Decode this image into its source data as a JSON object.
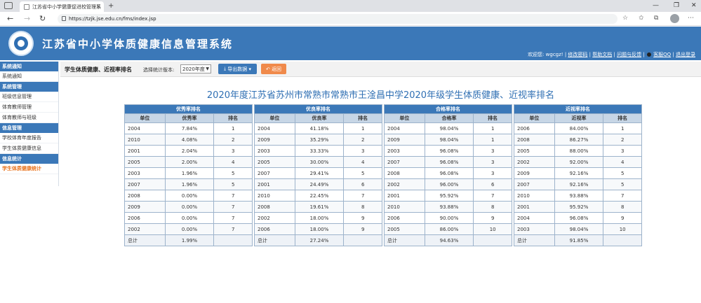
{
  "browser": {
    "tab_title": "江苏省中小学健康促进校管理系",
    "url": "https://tzjk.jse.edu.cn/fms/index.jsp"
  },
  "header": {
    "title": "江苏省中小学体质健康信息管理系统",
    "welcome": "欢迎您: wgcgz!",
    "links": [
      "修改密码",
      "帮助文档",
      "问题与反馈",
      "客服QQ",
      "退出登录"
    ]
  },
  "sidebar": {
    "groups": [
      {
        "label": "系统通知",
        "items": [
          {
            "label": "系统通知",
            "active": false
          }
        ]
      },
      {
        "label": "系统管理",
        "items": [
          {
            "label": "班级信息管理",
            "active": false
          },
          {
            "label": "体育教师管理",
            "active": false
          },
          {
            "label": "体育教师与班级",
            "active": false
          }
        ]
      },
      {
        "label": "信息管理",
        "items": [
          {
            "label": "学校体育年度报告",
            "active": false
          },
          {
            "label": "学生体质健康信息",
            "active": false
          }
        ]
      },
      {
        "label": "信息统计",
        "items": [
          {
            "label": "学生体质健康统计",
            "active": true
          }
        ]
      }
    ]
  },
  "toolbar": {
    "breadcrumb": "学生体质健康、近视率排名",
    "version_label": "选择统计版本:",
    "version_value": "2020年度",
    "export_label": "导出数据",
    "back_label": "返回"
  },
  "main": {
    "title": "2020年度江苏省苏州市常熟市常熟市王淦昌中学2020年级学生体质健康、近视率排名",
    "tables": [
      {
        "title": "优秀率排名",
        "headers": [
          "单位",
          "优秀率",
          "排名"
        ],
        "rows": [
          [
            "2004",
            "7.84%",
            "1"
          ],
          [
            "2010",
            "4.08%",
            "2"
          ],
          [
            "2001",
            "2.04%",
            "3"
          ],
          [
            "2005",
            "2.00%",
            "4"
          ],
          [
            "2003",
            "1.96%",
            "5"
          ],
          [
            "2007",
            "1.96%",
            "5"
          ],
          [
            "2008",
            "0.00%",
            "7"
          ],
          [
            "2009",
            "0.00%",
            "7"
          ],
          [
            "2006",
            "0.00%",
            "7"
          ],
          [
            "2002",
            "0.00%",
            "7"
          ]
        ],
        "total": [
          "总计",
          "1.99%",
          ""
        ]
      },
      {
        "title": "优良率排名",
        "headers": [
          "单位",
          "优良率",
          "排名"
        ],
        "rows": [
          [
            "2004",
            "41.18%",
            "1"
          ],
          [
            "2009",
            "35.29%",
            "2"
          ],
          [
            "2003",
            "33.33%",
            "3"
          ],
          [
            "2005",
            "30.00%",
            "4"
          ],
          [
            "2007",
            "29.41%",
            "5"
          ],
          [
            "2001",
            "24.49%",
            "6"
          ],
          [
            "2010",
            "22.45%",
            "7"
          ],
          [
            "2008",
            "19.61%",
            "8"
          ],
          [
            "2002",
            "18.00%",
            "9"
          ],
          [
            "2006",
            "18.00%",
            "9"
          ]
        ],
        "total": [
          "总计",
          "27.24%",
          ""
        ]
      },
      {
        "title": "合格率排名",
        "headers": [
          "单位",
          "合格率",
          "排名"
        ],
        "rows": [
          [
            "2004",
            "98.04%",
            "1"
          ],
          [
            "2009",
            "98.04%",
            "1"
          ],
          [
            "2003",
            "96.08%",
            "3"
          ],
          [
            "2007",
            "96.08%",
            "3"
          ],
          [
            "2008",
            "96.08%",
            "3"
          ],
          [
            "2002",
            "96.00%",
            "6"
          ],
          [
            "2001",
            "95.92%",
            "7"
          ],
          [
            "2010",
            "93.88%",
            "8"
          ],
          [
            "2006",
            "90.00%",
            "9"
          ],
          [
            "2005",
            "86.00%",
            "10"
          ]
        ],
        "total": [
          "总计",
          "94.63%",
          ""
        ]
      },
      {
        "title": "近视率排名",
        "headers": [
          "单位",
          "近视率",
          "排名"
        ],
        "rows": [
          [
            "2006",
            "84.00%",
            "1"
          ],
          [
            "2008",
            "86.27%",
            "2"
          ],
          [
            "2005",
            "88.00%",
            "3"
          ],
          [
            "2002",
            "92.00%",
            "4"
          ],
          [
            "2009",
            "92.16%",
            "5"
          ],
          [
            "2007",
            "92.16%",
            "5"
          ],
          [
            "2010",
            "93.88%",
            "7"
          ],
          [
            "2001",
            "95.92%",
            "8"
          ],
          [
            "2004",
            "96.08%",
            "9"
          ],
          [
            "2003",
            "98.04%",
            "10"
          ]
        ],
        "total": [
          "总计",
          "91.85%",
          ""
        ]
      }
    ]
  }
}
